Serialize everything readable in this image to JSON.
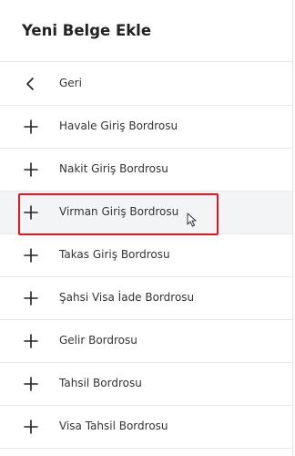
{
  "header": {
    "title": "Yeni Belge Ekle"
  },
  "menu": {
    "items": [
      {
        "label": "Geri",
        "icon": "chevron-left-icon"
      },
      {
        "label": "Havale Giriş Bordrosu",
        "icon": "plus-icon"
      },
      {
        "label": "Nakit Giriş Bordrosu",
        "icon": "plus-icon"
      },
      {
        "label": "Virman Giriş Bordrosu",
        "icon": "plus-icon"
      },
      {
        "label": "Takas Giriş Bordrosu",
        "icon": "plus-icon"
      },
      {
        "label": "Şahsi Visa İade Bordrosu",
        "icon": "plus-icon"
      },
      {
        "label": "Gelir Bordrosu",
        "icon": "plus-icon"
      },
      {
        "label": "Tahsil Bordrosu",
        "icon": "plus-icon"
      },
      {
        "label": "Visa Tahsil Bordrosu",
        "icon": "plus-icon"
      }
    ]
  },
  "colors": {
    "highlight": "#e8141d",
    "hover_bg": "#f3f4f5",
    "text": "#333333",
    "title": "#222222"
  }
}
